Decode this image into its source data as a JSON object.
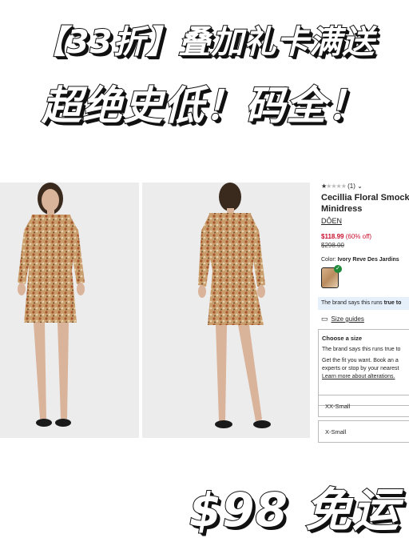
{
  "banners": {
    "line1": "【33折】叠加礼卡满送",
    "line2": "超绝史低！码全！",
    "line3": "$98 免运"
  },
  "product": {
    "rating_count": "(1)",
    "title_line1": "Cecillia Floral Smocke",
    "title_line2": "Minidress",
    "brand": "DÔEN",
    "sale_price": "$118.99",
    "discount": "(60% off)",
    "original_price": "$298.00",
    "color_label": "Color:",
    "color_value": "Ivory Reve Des Jardins",
    "fit_note_prefix": "The brand says this runs ",
    "fit_note_bold": "true to",
    "size_guides": "Size guides",
    "choose_size": {
      "heading": "Choose a size",
      "line1": "The brand says this runs true to",
      "line2": "Get the fit you want. Book an a",
      "line3": "experts or stop by your nearest",
      "link": "Learn more about alterations."
    },
    "sizes": [
      "XX-Small",
      "X-Small"
    ]
  },
  "colors": {
    "sale": "#c8102e",
    "fit_bar": "#e6f0fb",
    "check": "#1f8a3a"
  }
}
